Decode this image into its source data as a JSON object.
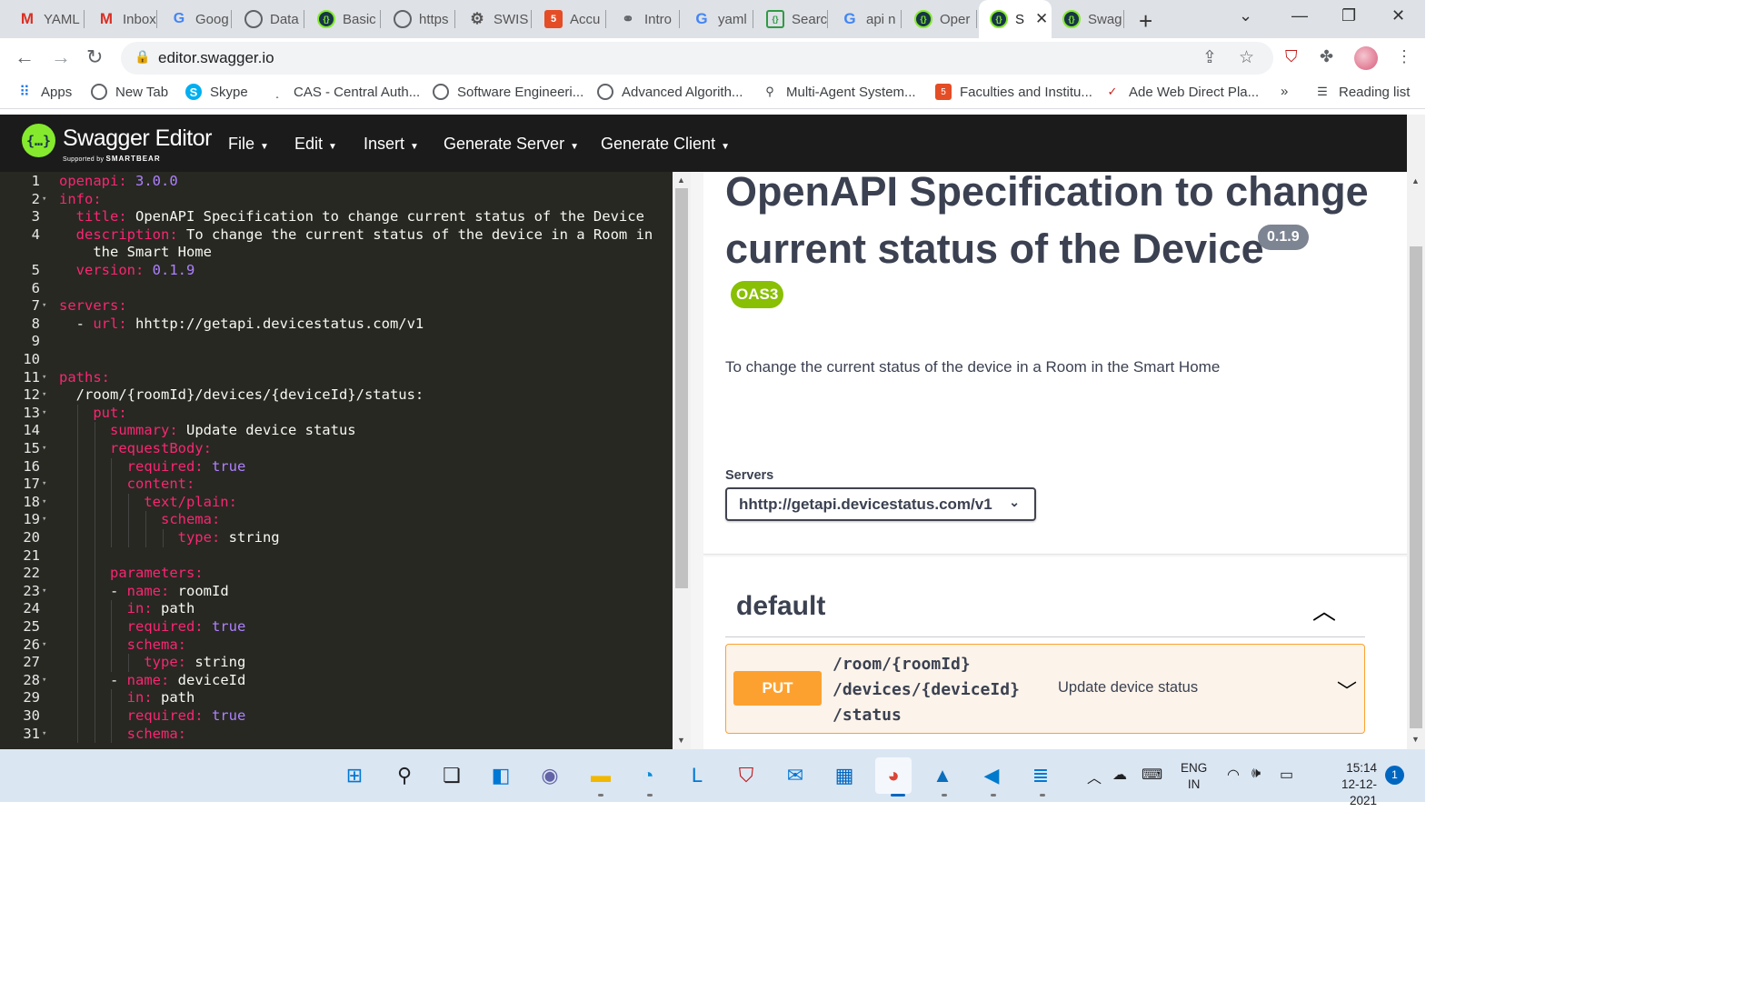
{
  "browser": {
    "tabs": [
      {
        "label": "YAML",
        "icon": "gmail-icon"
      },
      {
        "label": "Inbox",
        "icon": "gmail-icon"
      },
      {
        "label": "Goog",
        "icon": "google-docs-icon"
      },
      {
        "label": "Data",
        "icon": "globe-icon"
      },
      {
        "label": "Basic",
        "icon": "swagger-icon"
      },
      {
        "label": "https",
        "icon": "globe-icon"
      },
      {
        "label": "SWIS",
        "icon": "gear-icon"
      },
      {
        "label": "Accu",
        "icon": "html5-icon"
      },
      {
        "label": "Intro",
        "icon": "link-icon"
      },
      {
        "label": "yaml",
        "icon": "google-icon"
      },
      {
        "label": "Searc",
        "icon": "search-icon"
      },
      {
        "label": "api n",
        "icon": "google-icon"
      },
      {
        "label": "Oper",
        "icon": "swagger-icon"
      },
      {
        "label": "S",
        "icon": "swagger-icon",
        "active": true
      },
      {
        "label": "Swag",
        "icon": "swagger-icon"
      }
    ],
    "url": "editor.swagger.io",
    "bookmarks": [
      {
        "label": "Apps",
        "icon": "apps-grid-icon"
      },
      {
        "label": "New Tab",
        "icon": "globe-icon"
      },
      {
        "label": "Skype",
        "icon": "skype-icon"
      },
      {
        "label": "CAS - Central Auth...",
        "icon": "cas-icon"
      },
      {
        "label": "Software Engineeri...",
        "icon": "globe-icon"
      },
      {
        "label": "Advanced Algorith...",
        "icon": "globe-icon"
      },
      {
        "label": "Multi-Agent System...",
        "icon": "agent-icon"
      },
      {
        "label": "Faculties and Institu...",
        "icon": "html5-icon"
      },
      {
        "label": "Ade Web Direct Pla...",
        "icon": "check-icon"
      }
    ],
    "bookmarks_overflow": "»",
    "reading_list": "Reading list"
  },
  "swagger": {
    "title": "Swagger Editor",
    "subtitle_prefix": "Supported by",
    "subtitle_brand": "SMARTBEAR",
    "menus": [
      "File",
      "Edit",
      "Insert",
      "Generate Server",
      "Generate Client"
    ]
  },
  "editor": {
    "lines": [
      {
        "n": "1",
        "fold": false,
        "indent": 0,
        "parts": [
          [
            "k",
            "openapi:"
          ],
          [
            "n",
            " 3.0.0"
          ]
        ]
      },
      {
        "n": "2",
        "fold": true,
        "indent": 0,
        "parts": [
          [
            "k",
            "info:"
          ]
        ]
      },
      {
        "n": "3",
        "fold": false,
        "indent": 1,
        "parts": [
          [
            "k",
            "  title:"
          ],
          [
            "t",
            " OpenAPI Specification to change current status of the Device"
          ]
        ]
      },
      {
        "n": "4",
        "fold": false,
        "indent": 1,
        "parts": [
          [
            "k",
            "  description:"
          ],
          [
            "t",
            " To change the current status of the device in a Room in"
          ]
        ]
      },
      {
        "n": "",
        "fold": false,
        "indent": 1,
        "parts": [
          [
            "t",
            "    the Smart Home"
          ]
        ]
      },
      {
        "n": "5",
        "fold": false,
        "indent": 1,
        "parts": [
          [
            "k",
            "  version:"
          ],
          [
            "n",
            " 0.1.9"
          ]
        ]
      },
      {
        "n": "6",
        "fold": false,
        "indent": 0,
        "parts": []
      },
      {
        "n": "7",
        "fold": true,
        "indent": 0,
        "parts": [
          [
            "k",
            "servers:"
          ]
        ]
      },
      {
        "n": "8",
        "fold": false,
        "indent": 1,
        "parts": [
          [
            "t",
            "  - "
          ],
          [
            "k",
            "url:"
          ],
          [
            "t",
            " hhttp://getapi.devicestatus.com/v1"
          ]
        ]
      },
      {
        "n": "9",
        "fold": false,
        "indent": 1,
        "parts": []
      },
      {
        "n": "10",
        "fold": false,
        "indent": 0,
        "parts": []
      },
      {
        "n": "11",
        "fold": true,
        "indent": 0,
        "parts": [
          [
            "k",
            "paths:"
          ]
        ]
      },
      {
        "n": "12",
        "fold": true,
        "indent": 1,
        "parts": [
          [
            "t",
            "  /room/{roomId}/devices/{deviceId}/status:"
          ]
        ]
      },
      {
        "n": "13",
        "fold": true,
        "indent": 2,
        "parts": [
          [
            "k",
            "    put:"
          ]
        ]
      },
      {
        "n": "14",
        "fold": false,
        "indent": 3,
        "parts": [
          [
            "k",
            "      summary:"
          ],
          [
            "t",
            " Update device status"
          ]
        ]
      },
      {
        "n": "15",
        "fold": true,
        "indent": 3,
        "parts": [
          [
            "k",
            "      requestBody:"
          ]
        ]
      },
      {
        "n": "16",
        "fold": false,
        "indent": 4,
        "parts": [
          [
            "k",
            "        required:"
          ],
          [
            "n",
            " true"
          ]
        ]
      },
      {
        "n": "17",
        "fold": true,
        "indent": 4,
        "parts": [
          [
            "k",
            "        content:"
          ]
        ]
      },
      {
        "n": "18",
        "fold": true,
        "indent": 5,
        "parts": [
          [
            "k",
            "          text/plain:"
          ]
        ]
      },
      {
        "n": "19",
        "fold": true,
        "indent": 6,
        "parts": [
          [
            "k",
            "            schema:"
          ]
        ]
      },
      {
        "n": "20",
        "fold": false,
        "indent": 7,
        "parts": [
          [
            "k",
            "              type:"
          ],
          [
            "t",
            " string"
          ]
        ]
      },
      {
        "n": "21",
        "fold": false,
        "indent": 3,
        "parts": []
      },
      {
        "n": "22",
        "fold": false,
        "indent": 3,
        "parts": [
          [
            "k",
            "      parameters:"
          ]
        ]
      },
      {
        "n": "23",
        "fold": true,
        "indent": 3,
        "parts": [
          [
            "t",
            "      - "
          ],
          [
            "k",
            "name:"
          ],
          [
            "t",
            " roomId"
          ]
        ]
      },
      {
        "n": "24",
        "fold": false,
        "indent": 4,
        "parts": [
          [
            "k",
            "        in:"
          ],
          [
            "t",
            " path"
          ]
        ]
      },
      {
        "n": "25",
        "fold": false,
        "indent": 4,
        "parts": [
          [
            "k",
            "        required:"
          ],
          [
            "n",
            " true"
          ]
        ]
      },
      {
        "n": "26",
        "fold": true,
        "indent": 4,
        "parts": [
          [
            "k",
            "        schema:"
          ]
        ]
      },
      {
        "n": "27",
        "fold": false,
        "indent": 5,
        "parts": [
          [
            "k",
            "          type:"
          ],
          [
            "t",
            " string"
          ]
        ]
      },
      {
        "n": "28",
        "fold": true,
        "indent": 3,
        "parts": [
          [
            "t",
            "      - "
          ],
          [
            "k",
            "name:"
          ],
          [
            "t",
            " deviceId"
          ]
        ]
      },
      {
        "n": "29",
        "fold": false,
        "indent": 4,
        "parts": [
          [
            "k",
            "        in:"
          ],
          [
            "t",
            " path"
          ]
        ]
      },
      {
        "n": "30",
        "fold": false,
        "indent": 4,
        "parts": [
          [
            "k",
            "        required:"
          ],
          [
            "n",
            " true"
          ]
        ]
      },
      {
        "n": "31",
        "fold": true,
        "indent": 4,
        "parts": [
          [
            "k",
            "        schema:"
          ]
        ]
      }
    ]
  },
  "preview": {
    "title": "OpenAPI Specification to change current status of the Device",
    "version": "0.1.9",
    "oas_badge": "OAS3",
    "description": "To change the current status of the device in a Room in the Smart Home",
    "servers_label": "Servers",
    "server_selected": "hhttp://getapi.devicestatus.com/v1",
    "tag": "default",
    "operation": {
      "method": "PUT",
      "path": "/room/{roomId}\n/devices/{deviceId}\n/status",
      "summary": "Update device status"
    },
    "colors": {
      "put": "#fca130",
      "oas": "#89bf04",
      "swagger_green": "#85ea2d"
    }
  },
  "taskbar": {
    "apps": [
      "windows-start-icon",
      "search-icon",
      "task-view-icon",
      "widgets-icon",
      "chat-icon",
      "file-explorer-icon",
      "edge-icon",
      "l-app-icon",
      "mcafee-icon",
      "mail-icon",
      "store-icon",
      "chrome-icon",
      "photos-icon",
      "vscode-icon",
      "notepad-icon"
    ],
    "language": "ENG",
    "region": "IN",
    "time": "15:14",
    "date": "12-12-2021",
    "notifications": "1"
  }
}
